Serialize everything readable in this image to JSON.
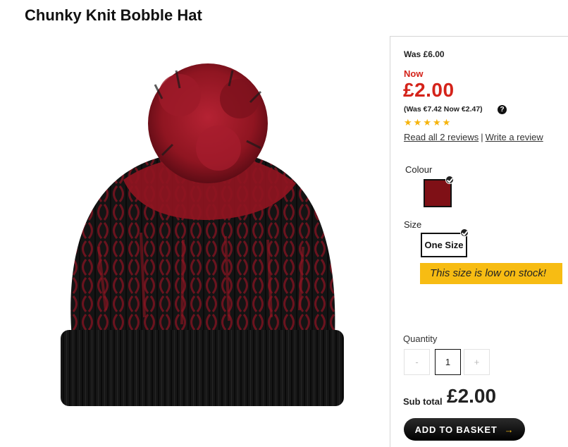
{
  "product": {
    "title": "Chunky Knit Bobble Hat"
  },
  "pricing": {
    "was": "Was £6.00",
    "now_label": "Now",
    "price": "£2.00",
    "euro": "(Was €7.42 Now €2.47)",
    "help_icon": "question-circle-icon"
  },
  "rating": {
    "stars": 5,
    "star_icon": "star-icon",
    "read_reviews": "Read all 2 reviews",
    "separator": "|",
    "write_review": "Write a review"
  },
  "colour": {
    "label": "Colour",
    "selected_swatch": "#7f1016"
  },
  "size": {
    "label": "Size",
    "selected": "One Size",
    "stock_message": "This size is low on stock!"
  },
  "quantity": {
    "label": "Quantity",
    "minus": "-",
    "value": "1",
    "plus": "+"
  },
  "subtotal": {
    "label": "Sub total",
    "value": "£2.00"
  },
  "basket": {
    "label": "ADD TO BASKET",
    "arrow": "→"
  },
  "colors": {
    "sale_red": "#d4231a",
    "star_yellow": "#f6b40c",
    "stock_banner": "#f7bc13",
    "hat_black": "#111111",
    "hat_red": "#8f1521"
  }
}
